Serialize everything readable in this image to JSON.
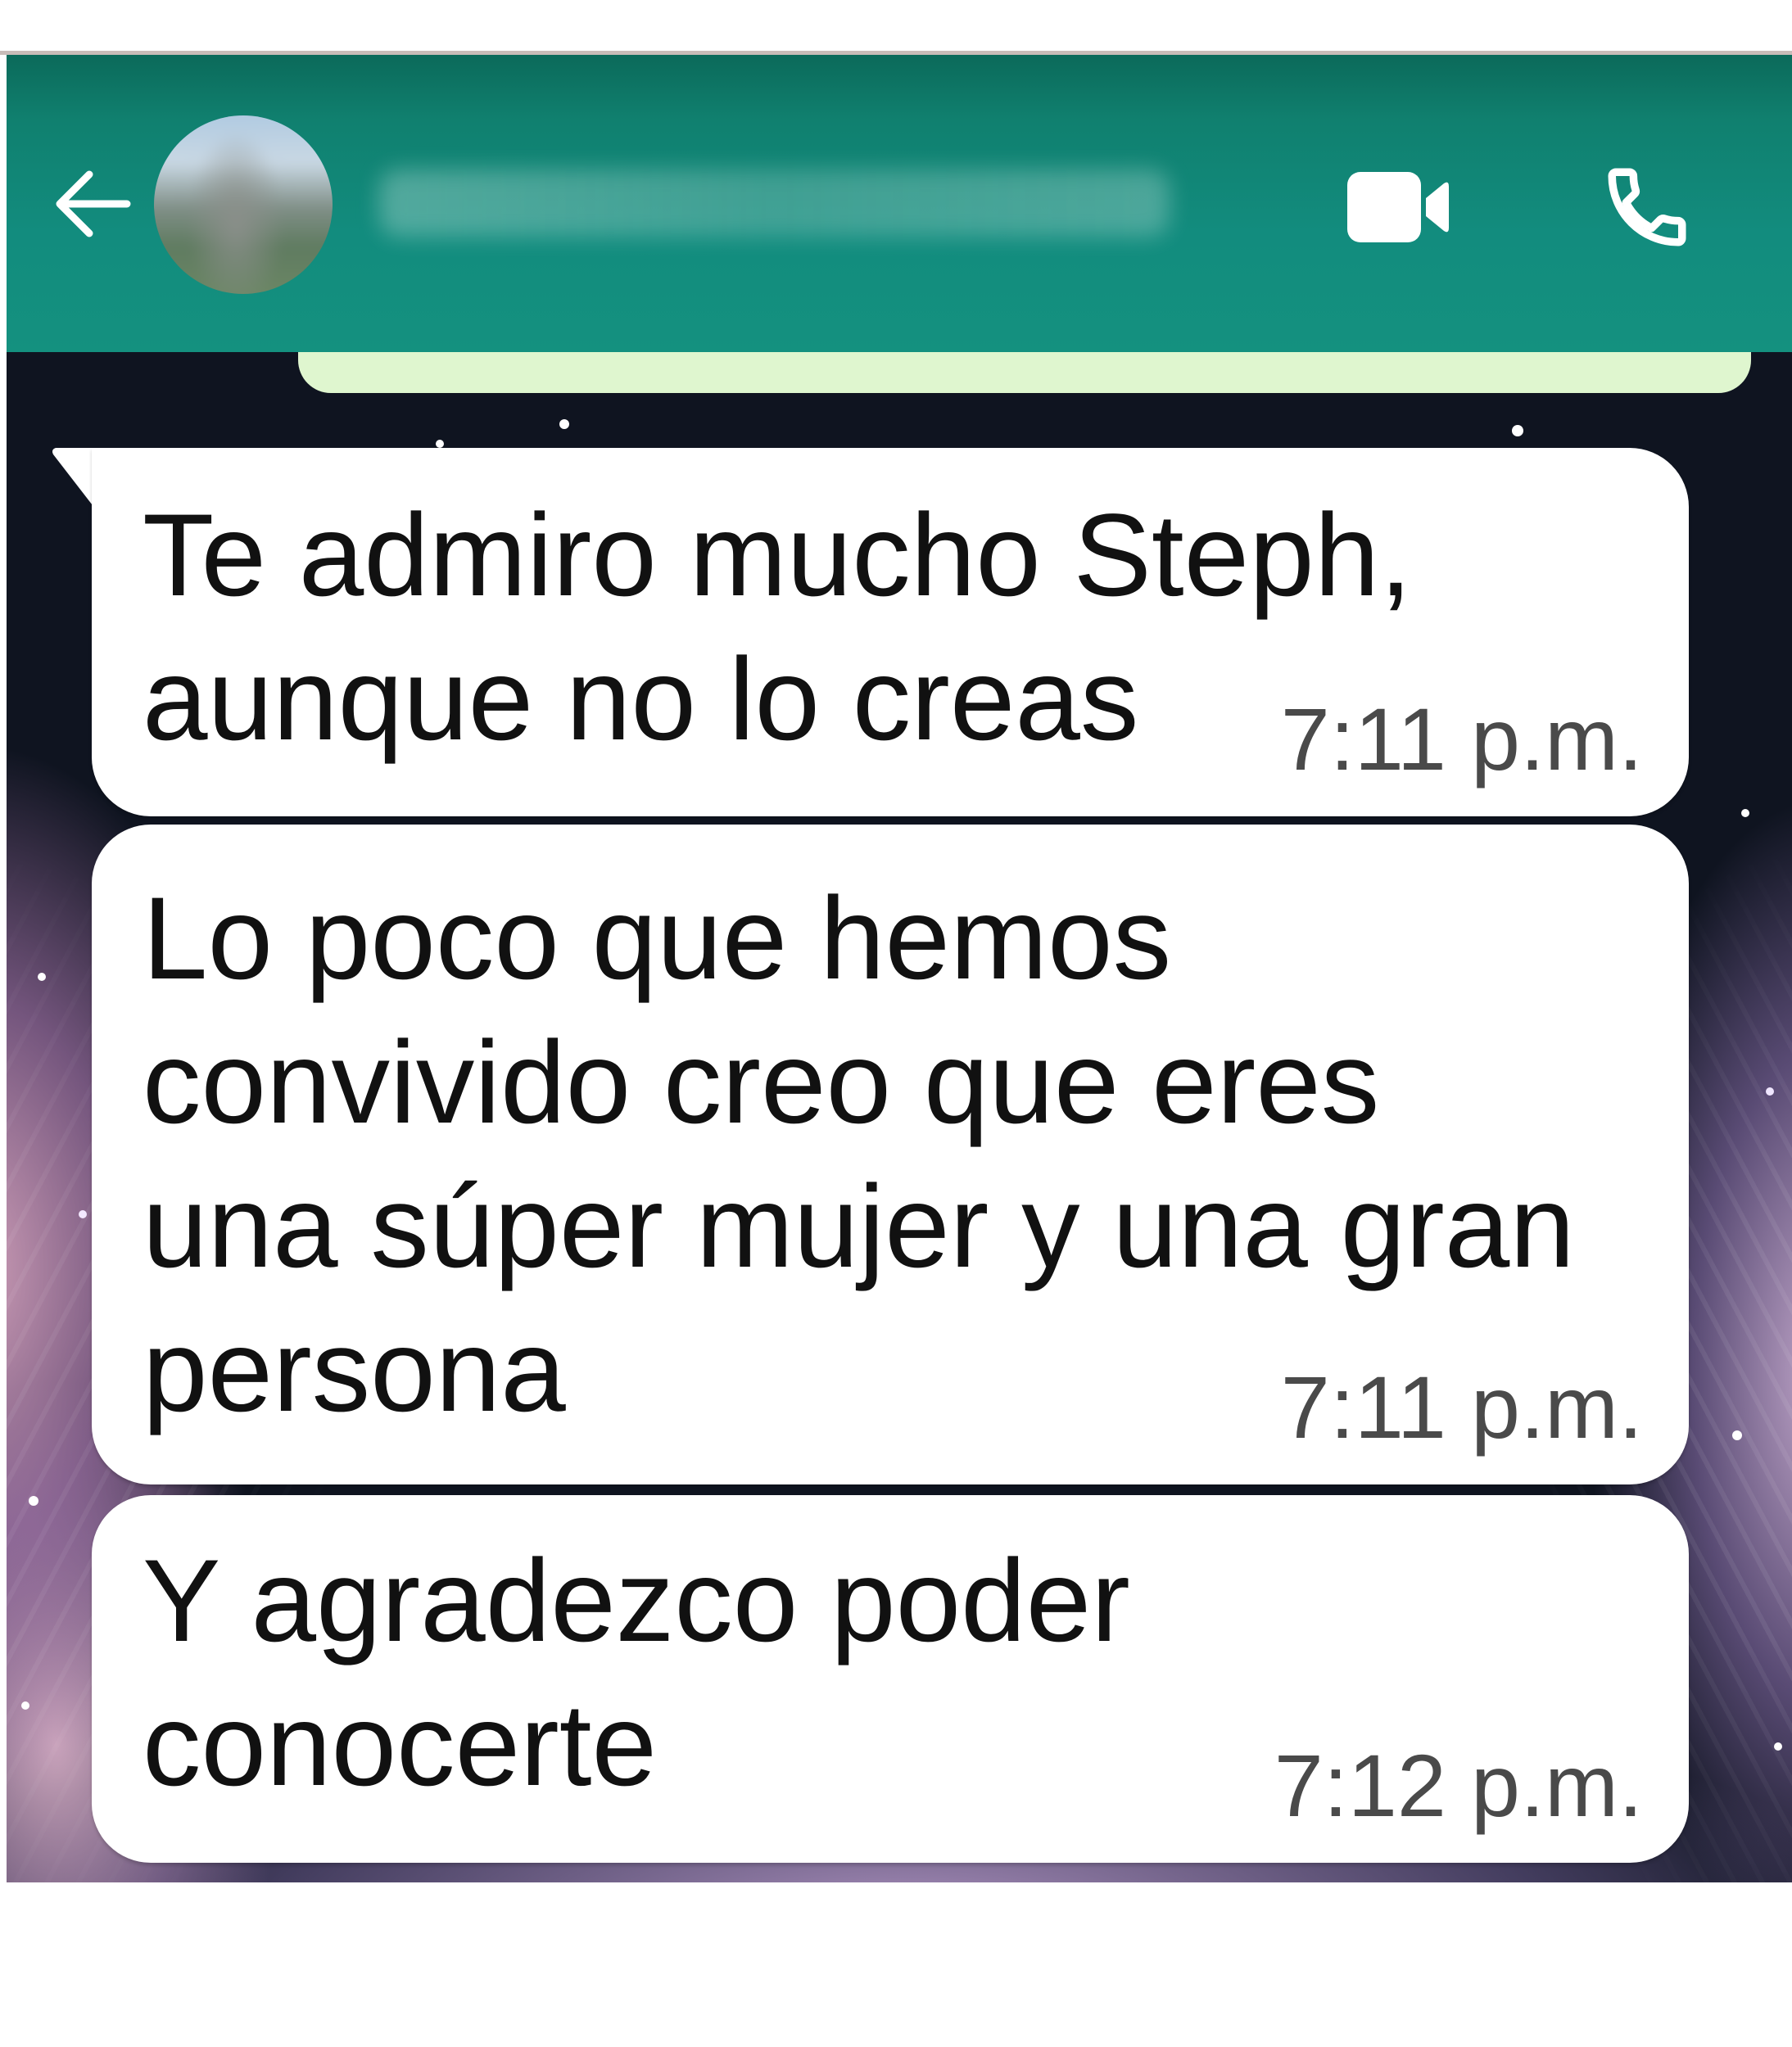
{
  "colors": {
    "header": "#128C7E",
    "incoming_bubble": "#FFFFFF",
    "outgoing_bubble": "#DFF6CF",
    "message_text": "#111111",
    "timestamp": "#4A4A4A"
  },
  "header": {
    "back_icon": "arrow-left-icon",
    "video_call_icon": "video-camera-icon",
    "voice_call_icon": "phone-icon"
  },
  "messages": [
    {
      "lines": [
        "Te admiro mucho Steph,",
        "aunque no lo creas"
      ],
      "time": "7:11 p.m."
    },
    {
      "lines": [
        "Lo poco que hemos",
        "convivido creo que eres",
        "una súper mujer y una gran",
        "persona"
      ],
      "time": "7:11 p.m."
    },
    {
      "lines": [
        "Y agradezco poder",
        "conocerte"
      ],
      "time": "7:12 p.m."
    }
  ]
}
